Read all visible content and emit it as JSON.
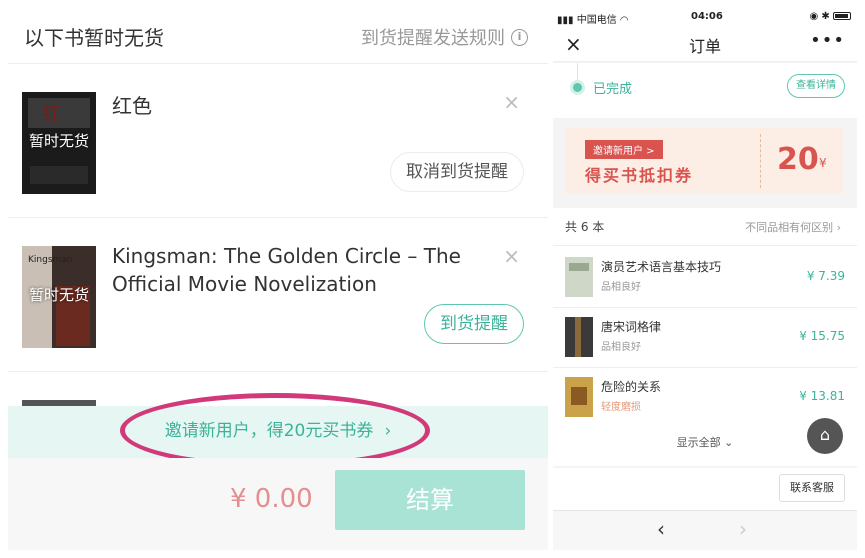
{
  "left_panel": {
    "header": {
      "title": "以下书暂时无货",
      "rules_link": "到货提醒发送规则",
      "info_icon": "i"
    },
    "books": [
      {
        "title": "红色",
        "cover_label": "暂时无货",
        "close": "×",
        "action": "取消到货提醒"
      },
      {
        "title_line1": "Kingsman: The Golden Circle – The",
        "title_line2": "Official Movie Novelization",
        "cover_label": "暂时无货",
        "close": "×",
        "action": "到货提醒"
      }
    ],
    "invite_banner": "邀请新用户，得20元买书券",
    "invite_chevron": "›",
    "total": "¥ 0.00",
    "checkout_button": "结算"
  },
  "right_panel": {
    "status_bar": {
      "carrier": "中国电信",
      "time": "04:06"
    },
    "nav": {
      "close": "×",
      "title": "订单",
      "more": "•••"
    },
    "order_status": "已完成",
    "view_details": "查看详情",
    "coupon": {
      "tag": "邀请新用户 >",
      "title": "得买书抵扣券",
      "amount": "20",
      "unit": "¥"
    },
    "list_header": {
      "count": "共 6 本",
      "note": "不同品相有何区别 ›"
    },
    "items": [
      {
        "title": "演员艺术语言基本技巧",
        "condition": "品相良好",
        "price": "¥ 7.39"
      },
      {
        "title": "唐宋词格律",
        "condition": "品相良好",
        "price": "¥ 15.75"
      },
      {
        "title": "危险的关系",
        "condition": "轻度磨损",
        "price": "¥ 13.81"
      }
    ],
    "show_all": "显示全部 ⌄",
    "home_icon": "⌂",
    "service_button": "联系客服",
    "browser_back": "‹",
    "browser_forward": "›"
  },
  "colors": {
    "accent_green": "#3bb39a",
    "highlight_ellipse": "#d1397b",
    "coupon_red": "#d9534f",
    "price_pink": "#e58e8e"
  }
}
